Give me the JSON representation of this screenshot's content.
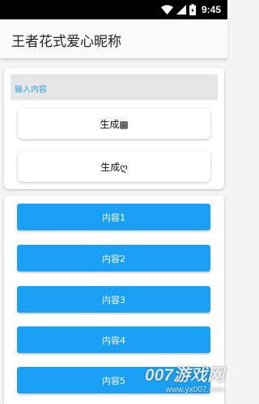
{
  "status_bar": {
    "time": "9:45",
    "icons": [
      "wifi-icon",
      "signal-icon",
      "battery-icon"
    ]
  },
  "app_bar": {
    "title": "王者花式爱心昵称"
  },
  "input": {
    "placeholder": "输入内容"
  },
  "generate_buttons": [
    {
      "label": "生成▩"
    },
    {
      "label": "生成ღ"
    }
  ],
  "content_buttons": [
    {
      "label": "内容1"
    },
    {
      "label": "内容2"
    },
    {
      "label": "内容3"
    },
    {
      "label": "内容4"
    },
    {
      "label": "内容5"
    }
  ],
  "watermark": {
    "brand": "007游戏网",
    "url": "www.yx007.com"
  },
  "colors": {
    "accent": "#1aa0f5",
    "hint": "#2d9fe0",
    "status_bar": "#000000",
    "app_bar": "#fafafa"
  }
}
